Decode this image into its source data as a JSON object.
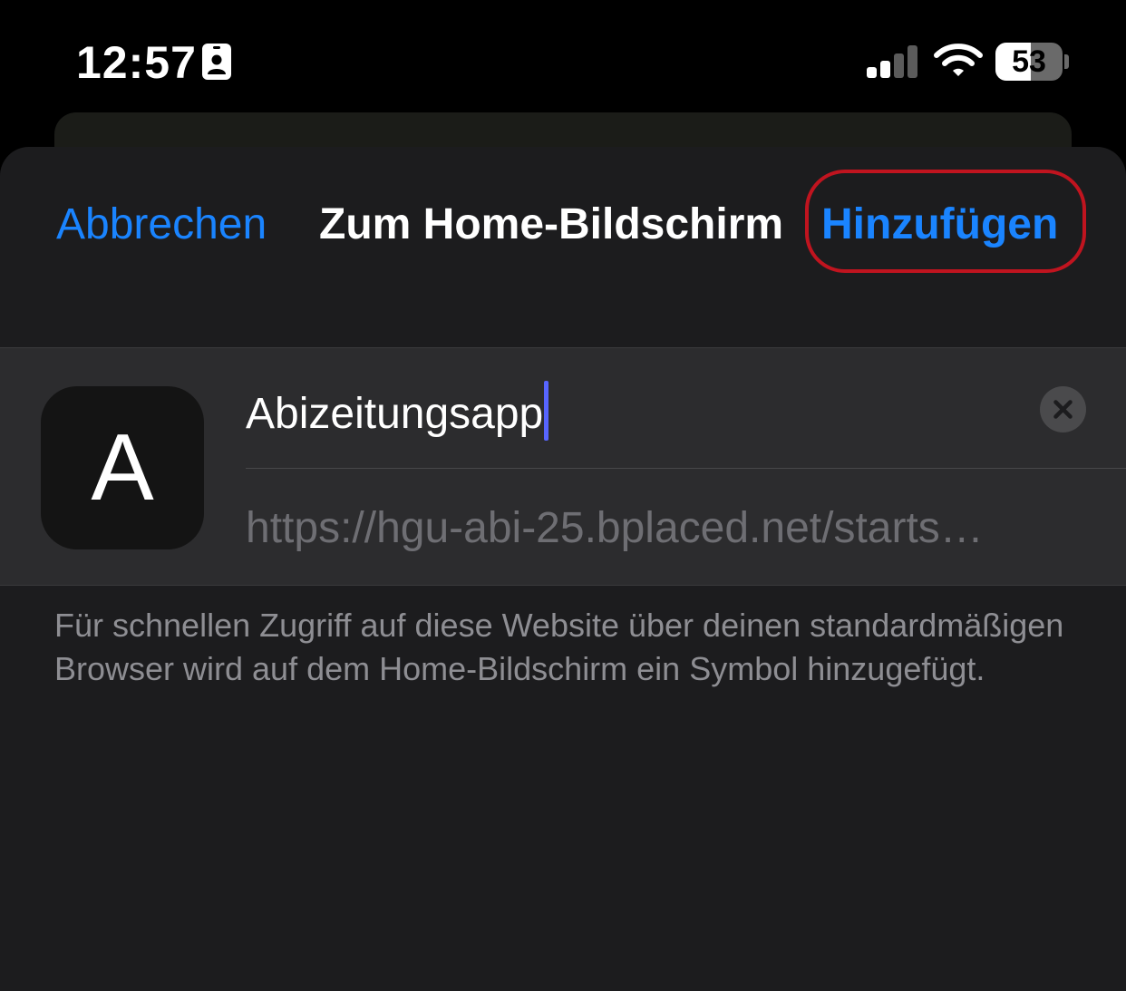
{
  "status_bar": {
    "time": "12:57",
    "battery_percent": 53,
    "battery_label": "53",
    "signal_bars_active": 2,
    "signal_bars_total": 4,
    "icons": [
      "contact-card-icon",
      "cellular-signal-icon",
      "wifi-icon",
      "battery-icon"
    ]
  },
  "sheet": {
    "cancel_label": "Abbrechen",
    "title": "Zum Home-Bildschirm",
    "add_label": "Hinzufügen",
    "highlight_color": "#c0141f"
  },
  "form": {
    "app_icon_letter": "A",
    "name_value": "Abizeitungsapp",
    "url_value": "https://hgu-abi-25.bplaced.net/starts…",
    "clear_icon": "clear-circle-icon"
  },
  "description": "Für schnellen Zugriff auf diese Website über deinen standardmäßigen Browser wird auf dem Home-Bildschirm ein Symbol hinzugefügt.",
  "colors": {
    "accent": "#1a84ff",
    "sheet_background": "#1c1c1e",
    "group_background": "#2c2c2e",
    "caret": "#5765ff"
  }
}
